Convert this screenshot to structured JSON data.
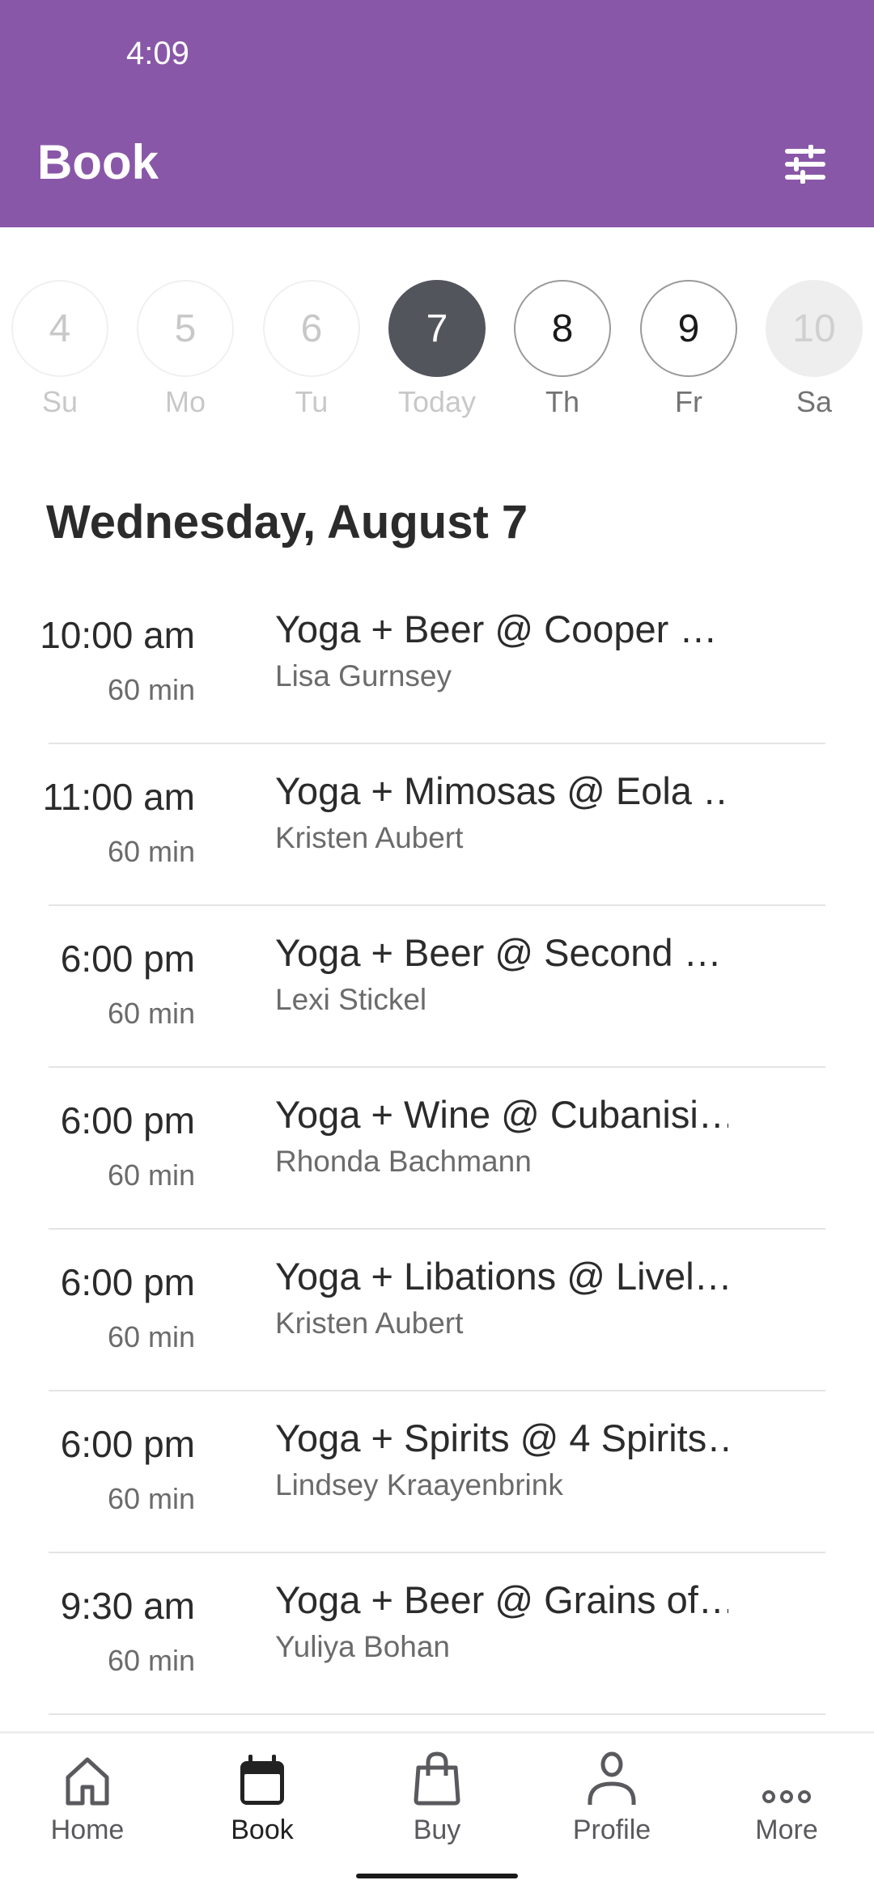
{
  "status_bar": {
    "time": "4:09"
  },
  "header": {
    "title": "Book",
    "filter_icon": "sliders-icon"
  },
  "colors": {
    "brand": "#8957a8",
    "selected_day": "#53555c"
  },
  "date_strip": [
    {
      "number": "4",
      "label": "Su",
      "state": "past"
    },
    {
      "number": "5",
      "label": "Mo",
      "state": "past"
    },
    {
      "number": "6",
      "label": "Tu",
      "state": "past"
    },
    {
      "number": "7",
      "label": "Today",
      "state": "selected"
    },
    {
      "number": "8",
      "label": "Th",
      "state": "future"
    },
    {
      "number": "9",
      "label": "Fr",
      "state": "future"
    },
    {
      "number": "10",
      "label": "Sa",
      "state": "disabled"
    }
  ],
  "date_heading": "Wednesday, August 7",
  "classes": [
    {
      "time": "10:00 am",
      "duration": "60 min",
      "name": "Yoga + Beer @ Cooper …",
      "instructor": "Lisa Gurnsey"
    },
    {
      "time": "11:00 am",
      "duration": "60 min",
      "name": "Yoga + Mimosas @ Eola …",
      "instructor": "Kristen Aubert"
    },
    {
      "time": "6:00 pm",
      "duration": "60 min",
      "name": "Yoga + Beer @ Second …",
      "instructor": "Lexi Stickel"
    },
    {
      "time": "6:00 pm",
      "duration": "60 min",
      "name": "Yoga + Wine @ Cubanisi…",
      "instructor": "Rhonda Bachmann"
    },
    {
      "time": "6:00 pm",
      "duration": "60 min",
      "name": "Yoga + Libations @ Livel…",
      "instructor": "Kristen Aubert"
    },
    {
      "time": "6:00 pm",
      "duration": "60 min",
      "name": "Yoga + Spirits @ 4 Spirits…",
      "instructor": "Lindsey Kraayenbrink"
    },
    {
      "time": "9:30 am",
      "duration": "60 min",
      "name": "Yoga + Beer @ Grains of…",
      "instructor": "Yuliya Bohan"
    }
  ],
  "bottom_nav": [
    {
      "label": "Home",
      "icon": "home-icon",
      "active": false
    },
    {
      "label": "Book",
      "icon": "calendar-icon",
      "active": true
    },
    {
      "label": "Buy",
      "icon": "shopping-bag-icon",
      "active": false
    },
    {
      "label": "Profile",
      "icon": "person-icon",
      "active": false
    },
    {
      "label": "More",
      "icon": "more-dots-icon",
      "active": false
    }
  ]
}
